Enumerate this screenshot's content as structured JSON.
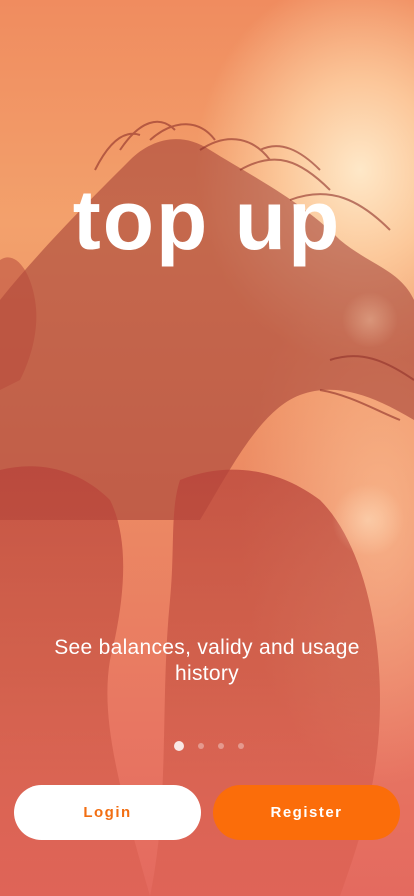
{
  "hero": {
    "title": "top up",
    "subtitle": "See balances, validy and usage history"
  },
  "pager": {
    "current_page": 1,
    "total_pages": 4
  },
  "actions": {
    "login_label": "Login",
    "register_label": "Register"
  },
  "theme": {
    "accent": "#fb6d0a",
    "login_text": "#f26e12",
    "button_light": "#ffffff"
  }
}
